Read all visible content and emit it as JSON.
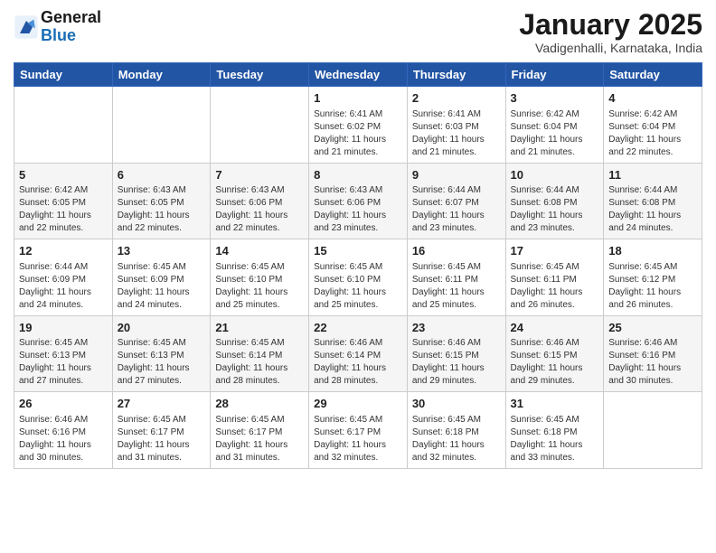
{
  "logo": {
    "line1": "General",
    "line2": "Blue"
  },
  "title": "January 2025",
  "subtitle": "Vadigenhalli, Karnataka, India",
  "weekdays": [
    "Sunday",
    "Monday",
    "Tuesday",
    "Wednesday",
    "Thursday",
    "Friday",
    "Saturday"
  ],
  "weeks": [
    [
      {
        "day": "",
        "info": ""
      },
      {
        "day": "",
        "info": ""
      },
      {
        "day": "",
        "info": ""
      },
      {
        "day": "1",
        "info": "Sunrise: 6:41 AM\nSunset: 6:02 PM\nDaylight: 11 hours\nand 21 minutes."
      },
      {
        "day": "2",
        "info": "Sunrise: 6:41 AM\nSunset: 6:03 PM\nDaylight: 11 hours\nand 21 minutes."
      },
      {
        "day": "3",
        "info": "Sunrise: 6:42 AM\nSunset: 6:04 PM\nDaylight: 11 hours\nand 21 minutes."
      },
      {
        "day": "4",
        "info": "Sunrise: 6:42 AM\nSunset: 6:04 PM\nDaylight: 11 hours\nand 22 minutes."
      }
    ],
    [
      {
        "day": "5",
        "info": "Sunrise: 6:42 AM\nSunset: 6:05 PM\nDaylight: 11 hours\nand 22 minutes."
      },
      {
        "day": "6",
        "info": "Sunrise: 6:43 AM\nSunset: 6:05 PM\nDaylight: 11 hours\nand 22 minutes."
      },
      {
        "day": "7",
        "info": "Sunrise: 6:43 AM\nSunset: 6:06 PM\nDaylight: 11 hours\nand 22 minutes."
      },
      {
        "day": "8",
        "info": "Sunrise: 6:43 AM\nSunset: 6:06 PM\nDaylight: 11 hours\nand 23 minutes."
      },
      {
        "day": "9",
        "info": "Sunrise: 6:44 AM\nSunset: 6:07 PM\nDaylight: 11 hours\nand 23 minutes."
      },
      {
        "day": "10",
        "info": "Sunrise: 6:44 AM\nSunset: 6:08 PM\nDaylight: 11 hours\nand 23 minutes."
      },
      {
        "day": "11",
        "info": "Sunrise: 6:44 AM\nSunset: 6:08 PM\nDaylight: 11 hours\nand 24 minutes."
      }
    ],
    [
      {
        "day": "12",
        "info": "Sunrise: 6:44 AM\nSunset: 6:09 PM\nDaylight: 11 hours\nand 24 minutes."
      },
      {
        "day": "13",
        "info": "Sunrise: 6:45 AM\nSunset: 6:09 PM\nDaylight: 11 hours\nand 24 minutes."
      },
      {
        "day": "14",
        "info": "Sunrise: 6:45 AM\nSunset: 6:10 PM\nDaylight: 11 hours\nand 25 minutes."
      },
      {
        "day": "15",
        "info": "Sunrise: 6:45 AM\nSunset: 6:10 PM\nDaylight: 11 hours\nand 25 minutes."
      },
      {
        "day": "16",
        "info": "Sunrise: 6:45 AM\nSunset: 6:11 PM\nDaylight: 11 hours\nand 25 minutes."
      },
      {
        "day": "17",
        "info": "Sunrise: 6:45 AM\nSunset: 6:11 PM\nDaylight: 11 hours\nand 26 minutes."
      },
      {
        "day": "18",
        "info": "Sunrise: 6:45 AM\nSunset: 6:12 PM\nDaylight: 11 hours\nand 26 minutes."
      }
    ],
    [
      {
        "day": "19",
        "info": "Sunrise: 6:45 AM\nSunset: 6:13 PM\nDaylight: 11 hours\nand 27 minutes."
      },
      {
        "day": "20",
        "info": "Sunrise: 6:45 AM\nSunset: 6:13 PM\nDaylight: 11 hours\nand 27 minutes."
      },
      {
        "day": "21",
        "info": "Sunrise: 6:45 AM\nSunset: 6:14 PM\nDaylight: 11 hours\nand 28 minutes."
      },
      {
        "day": "22",
        "info": "Sunrise: 6:46 AM\nSunset: 6:14 PM\nDaylight: 11 hours\nand 28 minutes."
      },
      {
        "day": "23",
        "info": "Sunrise: 6:46 AM\nSunset: 6:15 PM\nDaylight: 11 hours\nand 29 minutes."
      },
      {
        "day": "24",
        "info": "Sunrise: 6:46 AM\nSunset: 6:15 PM\nDaylight: 11 hours\nand 29 minutes."
      },
      {
        "day": "25",
        "info": "Sunrise: 6:46 AM\nSunset: 6:16 PM\nDaylight: 11 hours\nand 30 minutes."
      }
    ],
    [
      {
        "day": "26",
        "info": "Sunrise: 6:46 AM\nSunset: 6:16 PM\nDaylight: 11 hours\nand 30 minutes."
      },
      {
        "day": "27",
        "info": "Sunrise: 6:45 AM\nSunset: 6:17 PM\nDaylight: 11 hours\nand 31 minutes."
      },
      {
        "day": "28",
        "info": "Sunrise: 6:45 AM\nSunset: 6:17 PM\nDaylight: 11 hours\nand 31 minutes."
      },
      {
        "day": "29",
        "info": "Sunrise: 6:45 AM\nSunset: 6:17 PM\nDaylight: 11 hours\nand 32 minutes."
      },
      {
        "day": "30",
        "info": "Sunrise: 6:45 AM\nSunset: 6:18 PM\nDaylight: 11 hours\nand 32 minutes."
      },
      {
        "day": "31",
        "info": "Sunrise: 6:45 AM\nSunset: 6:18 PM\nDaylight: 11 hours\nand 33 minutes."
      },
      {
        "day": "",
        "info": ""
      }
    ]
  ]
}
